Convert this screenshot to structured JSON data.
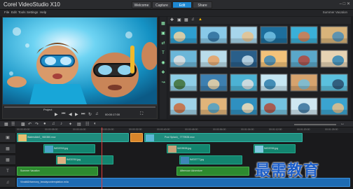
{
  "app": {
    "title": "Corel VideoStudio X10"
  },
  "workspace_tabs": {
    "welcome": "Welcome",
    "capture": "Capture",
    "edit": "Edit",
    "share": "Share"
  },
  "menu": {
    "file": "File",
    "edit": "Edit",
    "tools": "Tools",
    "settings": "Settings",
    "help": "Help"
  },
  "project_info": "Summer Vacation",
  "player": {
    "mode": "Project",
    "timecode": "00:00:17:00"
  },
  "library": {
    "thumbnail_count": 24
  },
  "timeline": {
    "ruler": [
      "00:00:00:00",
      "00:00:08:00",
      "00:00:16:00",
      "00:00:24:00",
      "00:00:32:00",
      "00:00:40:00",
      "00:00:48:00",
      "00:00:56:00",
      "00:01:04:00",
      "00:01:12:00",
      "00:01:20:00",
      "00:01:28:00"
    ],
    "video_clips": [
      "Waterslide2_ 960380.mov",
      "Pool Splash_ 7779928.mov"
    ],
    "overlay1_clips": [
      "IMG5763.jpg",
      "IMG5538.jpg",
      "IMG5765.jpg"
    ],
    "overlay2_clips": [
      "IMG5760.jpg",
      "IMG5777.jpg"
    ],
    "title_clips": [
      "Summer Vacation",
      "Afternoon Adventure"
    ],
    "audio_clips": [
      "Vivaldi&Harmony_beautycontemplation.m4a"
    ]
  },
  "watermark": "最需教育",
  "colors": {
    "accent": "#1e88d2",
    "video_clip": "#1f8d7e",
    "title_clip": "#2d8a2f",
    "audio_clip": "#1d6bb3"
  }
}
